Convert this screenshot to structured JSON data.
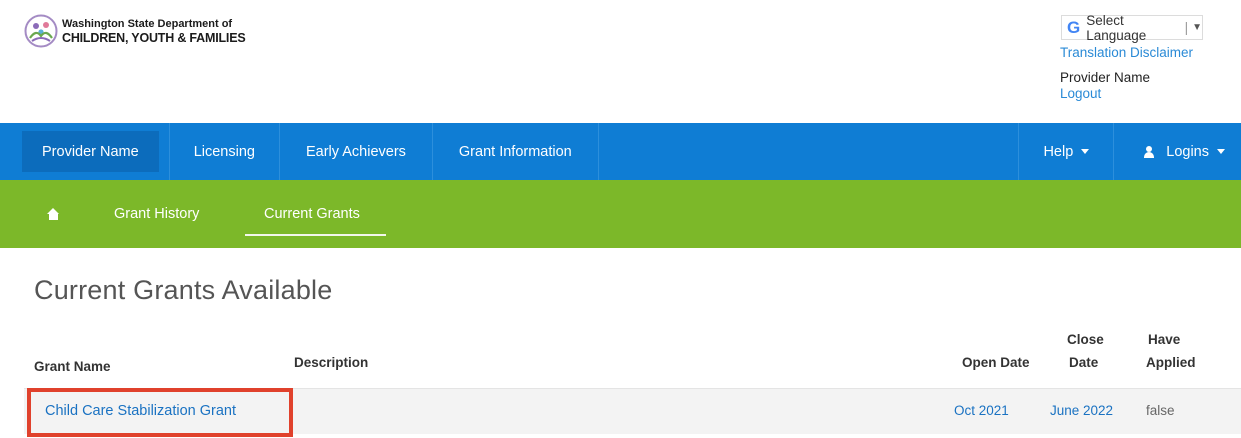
{
  "header": {
    "agency_line1": "Washington State Department of",
    "agency_line2": "CHILDREN, YOUTH & FAMILIES",
    "language_select": "Select Language",
    "translation_disclaimer": "Translation Disclaimer",
    "provider_name": "Provider Name",
    "logout": "Logout"
  },
  "main_nav": {
    "items": [
      "Provider Name",
      "Licensing",
      "Early Achievers",
      "Grant Information"
    ],
    "help": "Help",
    "logins": "Logins"
  },
  "sub_nav": {
    "items": [
      "Grant History",
      "Current Grants"
    ]
  },
  "page": {
    "title": "Current Grants Available"
  },
  "table": {
    "headers": {
      "grant_name": "Grant Name",
      "description": "Description",
      "open_date": "Open Date",
      "close_date_1": "Close",
      "close_date_2": "Date",
      "have_applied_1": "Have",
      "have_applied_2": "Applied"
    },
    "rows": [
      {
        "grant_name": "Child Care Stabilization Grant",
        "description": "",
        "open_date": "Oct 2021",
        "close_date": "June 2022",
        "have_applied": "false"
      }
    ]
  },
  "colors": {
    "nav_blue": "#0f7dd4",
    "nav_green": "#7cb829",
    "link": "#1a72c2",
    "highlight": "#e0412c"
  }
}
